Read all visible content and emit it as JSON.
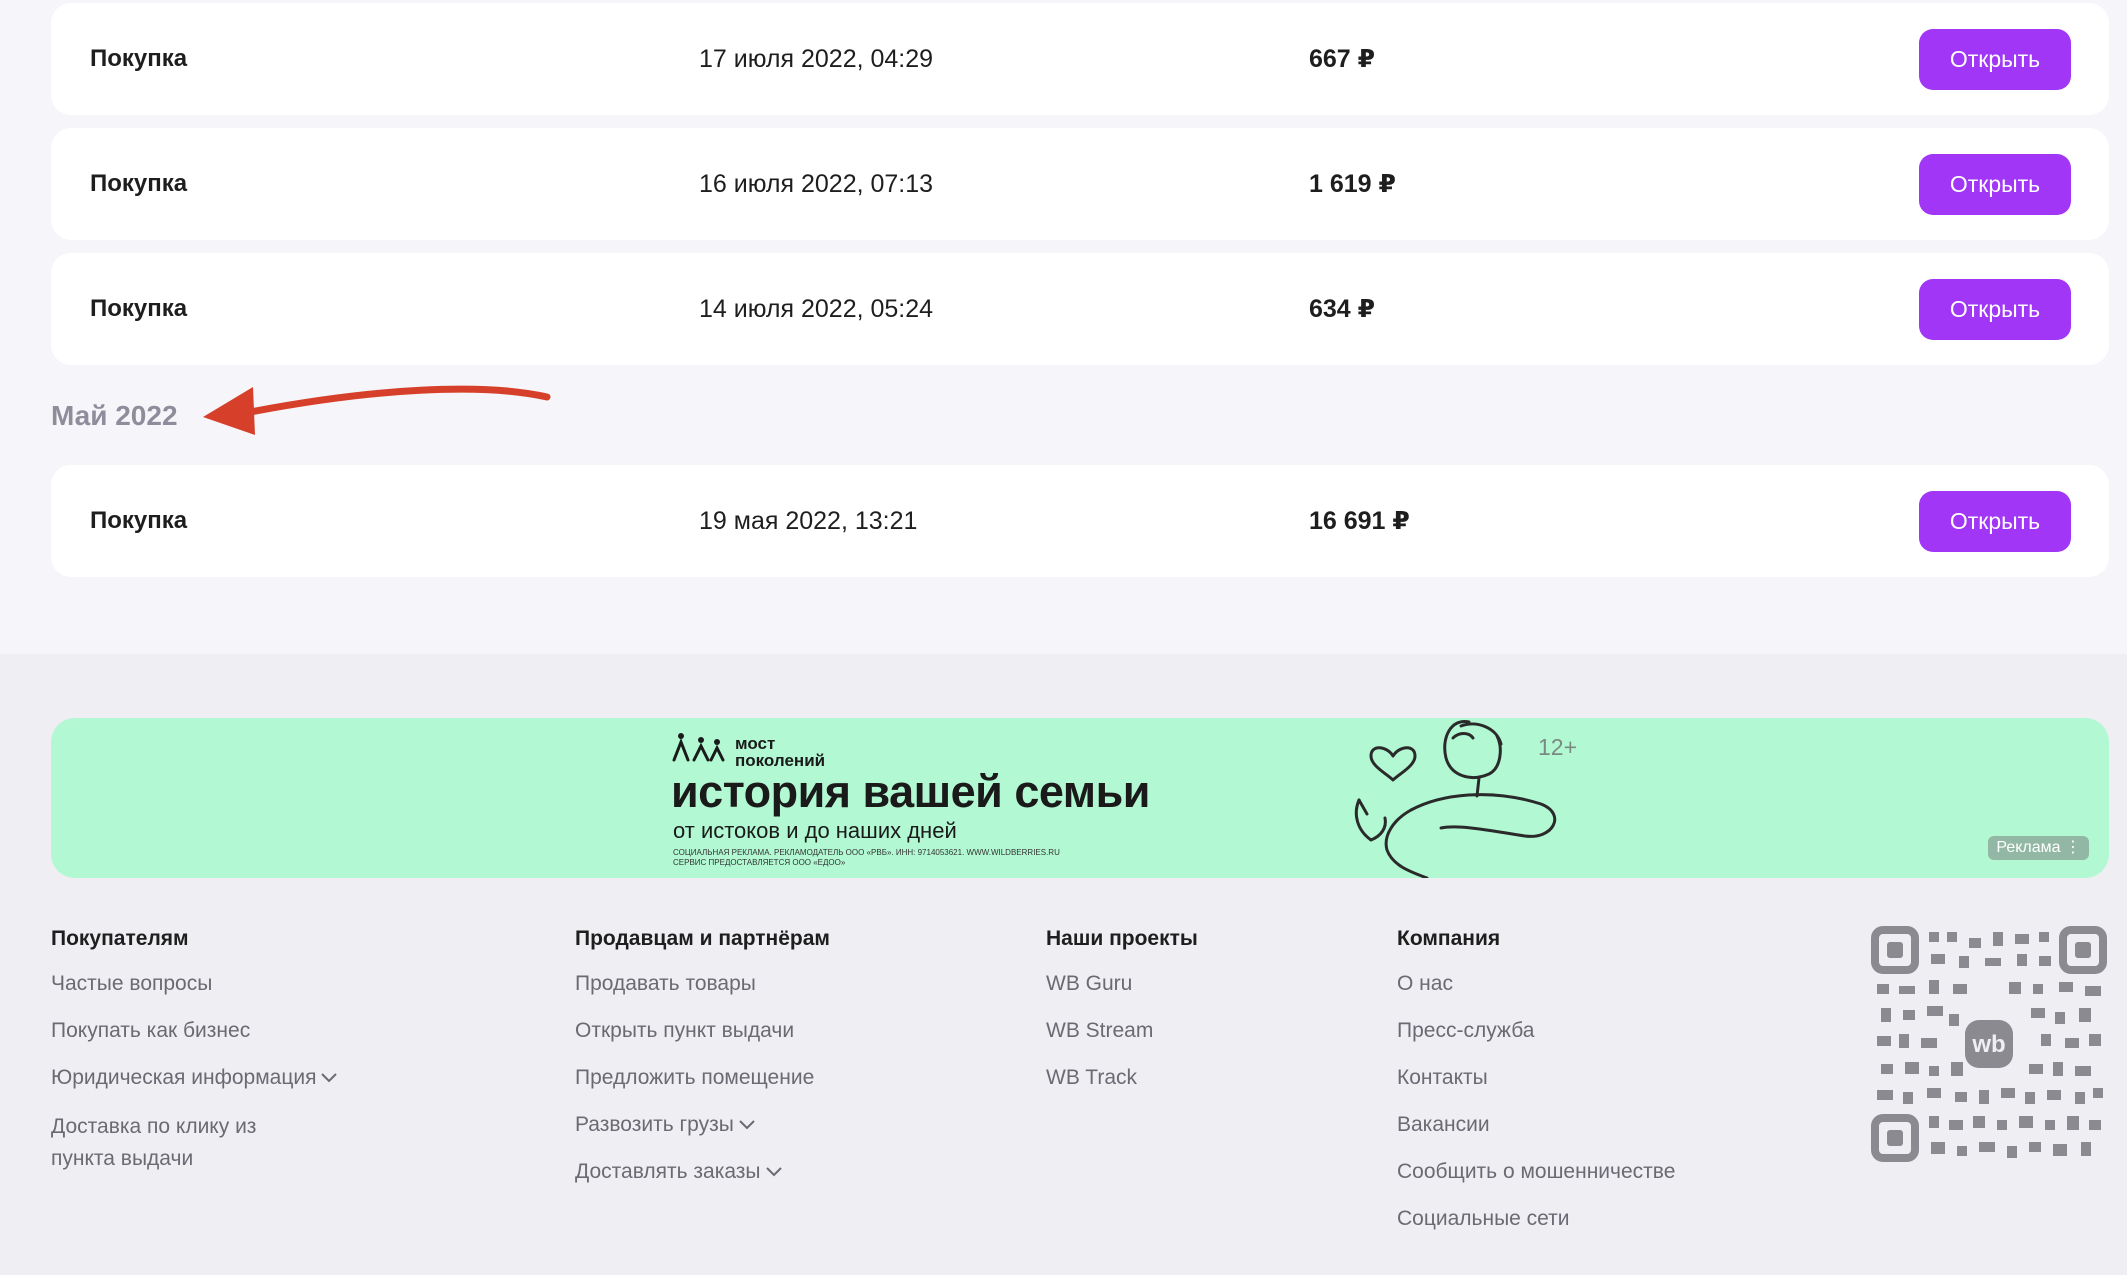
{
  "orders": [
    {
      "type": "Покупка",
      "date": "17 июля 2022, 04:29",
      "sum": "667 ₽",
      "button": "Открыть"
    },
    {
      "type": "Покупка",
      "date": "16 июля 2022, 07:13",
      "sum": "1 619 ₽",
      "button": "Открыть"
    },
    {
      "type": "Покупка",
      "date": "14 июля 2022, 05:24",
      "sum": "634 ₽",
      "button": "Открыть"
    }
  ],
  "month_group": {
    "title": "Май 2022",
    "orders": [
      {
        "type": "Покупка",
        "date": "19 мая 2022, 13:21",
        "sum": "16 691 ₽",
        "button": "Открыть"
      }
    ]
  },
  "banner": {
    "brand_line1": "мост",
    "brand_line2": "поколений",
    "headline": "история вашей семьи",
    "subline": "от истоков и до наших дней",
    "fine_print_1": "СОЦИАЛЬНАЯ РЕКЛАМА. РЕКЛАМОДАТЕЛЬ ООО «РВБ». ИНН: 9714053621. WWW.WILDBERRIES.RU",
    "fine_print_2": "СЕРВИС ПРЕДОСТАВЛЯЕТСЯ ООО «ЕДОО»",
    "age": "12+",
    "ad_label": "Реклама ⋮",
    "background": "#b2f9d3"
  },
  "footer": {
    "buyers": {
      "title": "Покупателям",
      "links": [
        "Частые вопросы",
        "Покупать как бизнес",
        "Юридическая информация",
        "Доставка по клику из пункта выдачи"
      ]
    },
    "sellers": {
      "title": "Продавцам и партнёрам",
      "links": [
        "Продавать товары",
        "Открыть пункт выдачи",
        "Предложить помещение",
        "Развозить грузы",
        "Доставлять заказы"
      ]
    },
    "projects": {
      "title": "Наши проекты",
      "links": [
        "WB Guru",
        "WB Stream",
        "WB Track"
      ]
    },
    "company": {
      "title": "Компания",
      "links": [
        "О нас",
        "Пресс-служба",
        "Контакты",
        "Вакансии",
        "Сообщить о мошенничестве",
        "Социальные сети"
      ]
    },
    "qr_logo": "wb"
  },
  "colors": {
    "accent": "#a136f7",
    "annotation_arrow": "#d6402a",
    "muted_text": "#8f8d9b"
  },
  "icons": [
    "arrow-annotation-icon",
    "chevron-down-icon",
    "qr-code-icon",
    "family-logo-icon"
  ]
}
